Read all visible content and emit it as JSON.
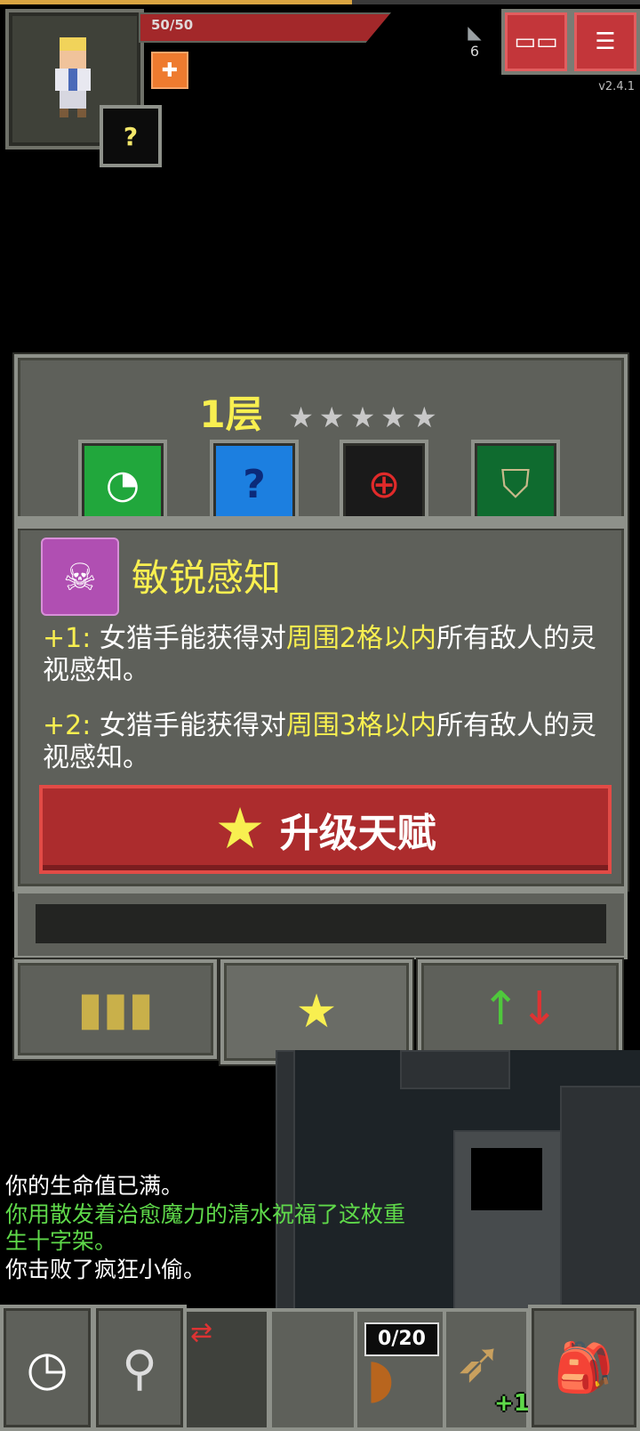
{
  "status": {
    "hp_text": "50/50",
    "hp_fraction": 1.0,
    "xp_fraction": 0.55,
    "level_badge": "?",
    "depth": "6",
    "version": "v2.4.1",
    "buff_icon": "cross-buff-icon"
  },
  "top_buttons": {
    "journal_icon": "journal-icon",
    "menu_icon": "menu-icon"
  },
  "talent_panel": {
    "floor_label": "1层",
    "stars": "★★★★★",
    "tabs": [
      "talent-tab-icon-1",
      "talent-tab-icon-2",
      "talent-tab-icon-3",
      "talent-tab-icon-4"
    ],
    "talent_name": "敏锐感知",
    "desc1_prefix": "+1:",
    "desc1_a": "女猎手能获得对",
    "desc1_hl": "周围2格以内",
    "desc1_b": "所有敌人的灵视感知。",
    "desc2_prefix": "+2:",
    "desc2_a": "女猎手能获得对",
    "desc2_hl": "周围3格以内",
    "desc2_b": "所有敌人的灵视感知。",
    "upgrade_label": "升级天赋"
  },
  "bottom_tabs": [
    "stats-tab-icon",
    "talents-tab-icon",
    "buffs-tab-icon"
  ],
  "log": {
    "line1": "你的生命值已满。",
    "line2": "你用散发着治愈魔力的清水祝福了这枚重",
    "line3": "生十字架。",
    "line4": "你击败了疯狂小偷。"
  },
  "toolbar": {
    "wait_icon": "clock-icon",
    "search_icon": "magnifier-icon",
    "swap_icon": "swap-icon",
    "quiver_count": "0/20",
    "bow_bonus": "+1",
    "backpack_icon": "backpack-icon"
  },
  "colors": {
    "accent_yellow": "#f8ef50",
    "button_red": "#ac2c2d",
    "log_green": "#5fd94a"
  }
}
